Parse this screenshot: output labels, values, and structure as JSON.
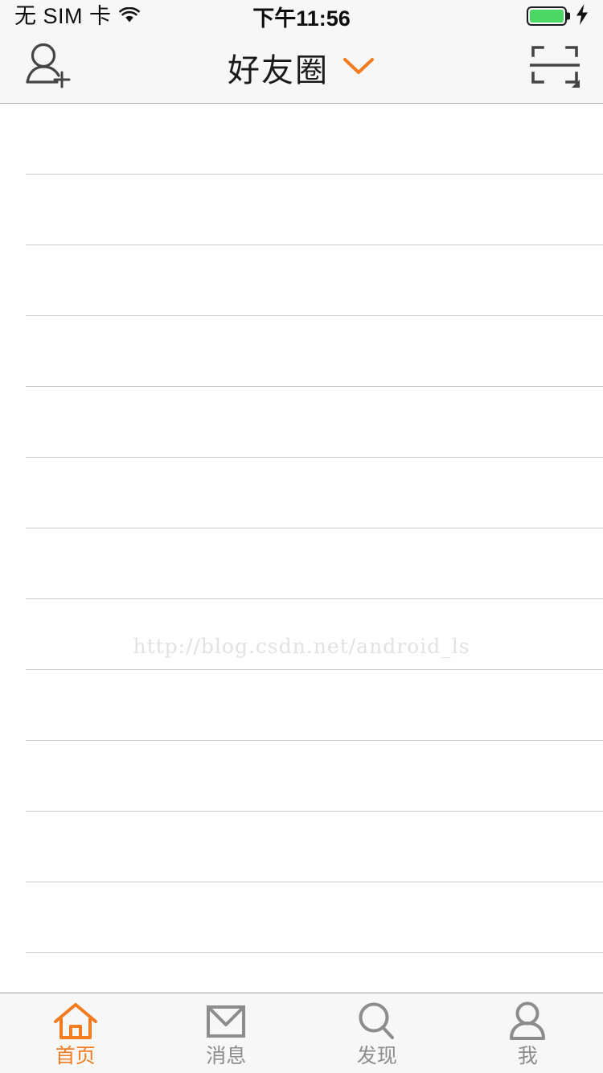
{
  "status_bar": {
    "carrier": "无 SIM 卡",
    "wifi_icon": "wifi-icon",
    "time": "下午11:56",
    "battery_icon": "battery-icon",
    "battery_level_percent": 100,
    "charging_icon": "lightning-bolt-icon"
  },
  "nav_bar": {
    "add_friend_icon": "add-friend-icon",
    "title": "好友圈",
    "caret_icon": "chevron-down-icon",
    "scan_icon": "qr-scan-icon"
  },
  "colors": {
    "accent": "#f47b20",
    "nav_background": "#f7f7f7",
    "separator": "#c8c8c8",
    "inactive_tab": "#8c8c8c",
    "battery_green": "#4cd764"
  },
  "content": {
    "rows": [
      {
        "label": ""
      },
      {
        "label": ""
      },
      {
        "label": ""
      },
      {
        "label": ""
      },
      {
        "label": ""
      },
      {
        "label": ""
      },
      {
        "label": ""
      },
      {
        "label": ""
      },
      {
        "label": ""
      },
      {
        "label": ""
      },
      {
        "label": ""
      },
      {
        "label": ""
      }
    ],
    "watermark": "http://blog.csdn.net/android_ls"
  },
  "tab_bar": {
    "items": [
      {
        "label": "首页",
        "icon": "home-icon",
        "active": true
      },
      {
        "label": "消息",
        "icon": "envelope-icon",
        "active": false
      },
      {
        "label": "发现",
        "icon": "magnifier-icon",
        "active": false
      },
      {
        "label": "我",
        "icon": "person-icon",
        "active": false
      }
    ]
  }
}
